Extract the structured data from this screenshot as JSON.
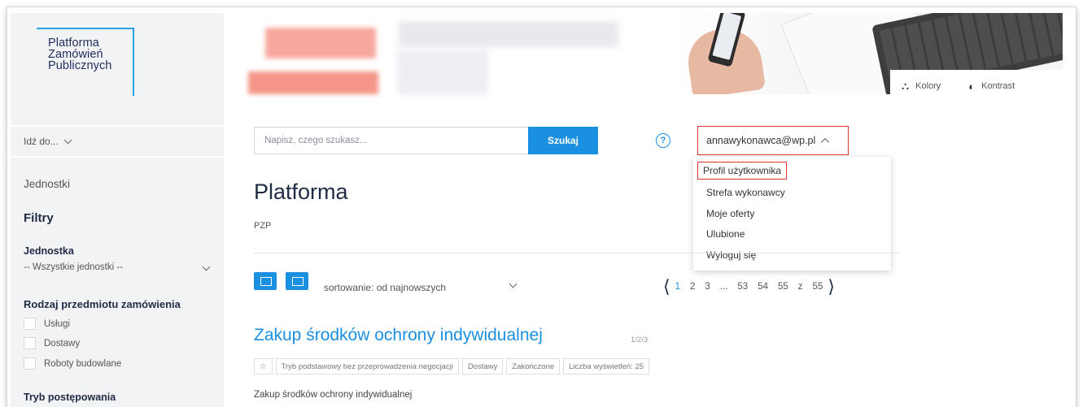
{
  "logo": {
    "line1": "Platforma",
    "line2": "Zamówień",
    "line3": "Publicznych"
  },
  "sidebar": {
    "goto_label": "Idź do...",
    "units_link": "Jednostki",
    "filters_heading": "Filtry",
    "unit_heading": "Jednostka",
    "unit_select_value": "-- Wszystkie jednostki --",
    "order_type_heading": "Rodzaj przedmiotu zamówienia",
    "order_types": [
      "Usługi",
      "Dostawy",
      "Roboty budowlane"
    ],
    "next_heading_cut": "Tryb postępowania"
  },
  "header_tools": {
    "colors_label": "Kolory",
    "contrast_label": "Kontrast"
  },
  "search": {
    "placeholder": "Napisz, czego szukasz...",
    "button_label": "Szukaj",
    "help_label": "?"
  },
  "user_menu": {
    "email": "annawykonawca@wp.pl",
    "items": [
      "Profil użytkownika",
      "Strefa wykonawcy",
      "Moje oferty",
      "Ulubione",
      "Wyloguj się"
    ]
  },
  "page": {
    "title": "Platforma",
    "subtitle": "PZP"
  },
  "toolbar": {
    "sort_label": "sortowanie: od najnowszych"
  },
  "pagination": {
    "pages": [
      "1",
      "2",
      "3",
      "...",
      "53",
      "54",
      "55",
      "z",
      "55"
    ],
    "current": "1"
  },
  "result": {
    "title": "Zakup środków ochrony indywidualnej",
    "number": "1/2/3",
    "star": "☆",
    "tags": [
      "Tryb podstawowy bez przeprowadzenia negocjacji",
      "Dostawy",
      "Zakończone",
      "Liczba wyświetleń: 25"
    ],
    "description": "Zakup środków ochrony indywidualnej"
  },
  "colors": {
    "accent": "#1b8fe0",
    "highlight": "#e03131",
    "sidebar_bg": "#f2f3f5"
  }
}
